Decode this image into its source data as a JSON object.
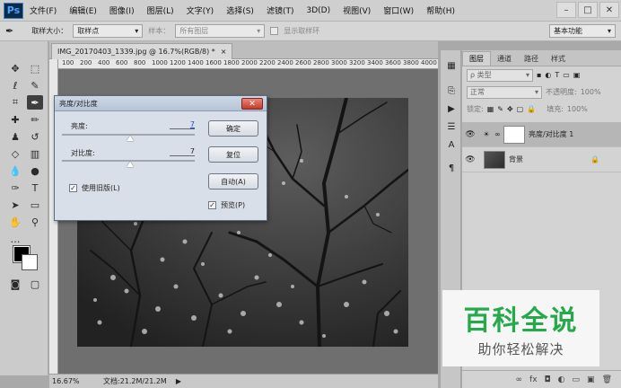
{
  "app": {
    "logo": "Ps"
  },
  "menu": [
    "文件(F)",
    "编辑(E)",
    "图像(I)",
    "图层(L)",
    "文字(Y)",
    "选择(S)",
    "滤镜(T)",
    "3D(D)",
    "视图(V)",
    "窗口(W)",
    "帮助(H)"
  ],
  "window_controls": {
    "minimize": "–",
    "maximize": "□",
    "close": "✕"
  },
  "options_bar": {
    "sample_size_label": "取样大小：",
    "sample_size_value": "取样点",
    "sample_label": "样本：",
    "sample_value": "所有图层",
    "show_ring_label": "显示取样环",
    "workspace": "基本功能"
  },
  "document": {
    "tab_title": "IMG_20170403_1339.jpg @ 16.7%(RGB/8) *",
    "tab_close": "×",
    "ruler_numbers": [
      "100",
      "200",
      "400",
      "600",
      "800",
      "1000",
      "1200",
      "1400",
      "1600",
      "1800",
      "2000",
      "2200",
      "2400",
      "2600",
      "2800",
      "3000",
      "3200",
      "3400",
      "3600",
      "3800",
      "4000"
    ],
    "zoom": "16.67%",
    "doc_size": "文档:21.2M/21.2M",
    "status_arrow": "▶"
  },
  "dialog": {
    "title": "亮度/对比度",
    "close": "✕",
    "brightness_label": "亮度:",
    "brightness_value": "7",
    "brightness_level": 0.514,
    "contrast_label": "对比度:",
    "contrast_value": "7",
    "contrast_level": 0.514,
    "use_legacy_label": "使用旧版(L)",
    "use_legacy_checked": true,
    "ok_label": "确定",
    "reset_label": "复位",
    "auto_label": "自动(A)",
    "preview_label": "预览(P)",
    "preview_checked": true
  },
  "layers_panel": {
    "tabs": [
      "图层",
      "通道",
      "路径",
      "样式"
    ],
    "filter_type": "ρ 类型",
    "blend_mode": "正常",
    "opacity_label": "不透明度:",
    "opacity_value": "100%",
    "lock_label": "锁定:",
    "fill_label": "填充:",
    "fill_value": "100%",
    "layers": [
      {
        "name": "亮度/对比度 1",
        "selected": true
      },
      {
        "name": "背景",
        "selected": false
      }
    ],
    "lock_icon": "🔒",
    "footer_icons": [
      "∞",
      "fx",
      "◘",
      "◐",
      "▭",
      "▣",
      "🗑"
    ]
  },
  "watermark": {
    "brand": "百科全说",
    "sub": "助你轻松解决"
  },
  "colors": {
    "accent": "#26a94a",
    "dialog_bg": "#d9dfe8",
    "canvas_bg": "#6f6f6f"
  }
}
